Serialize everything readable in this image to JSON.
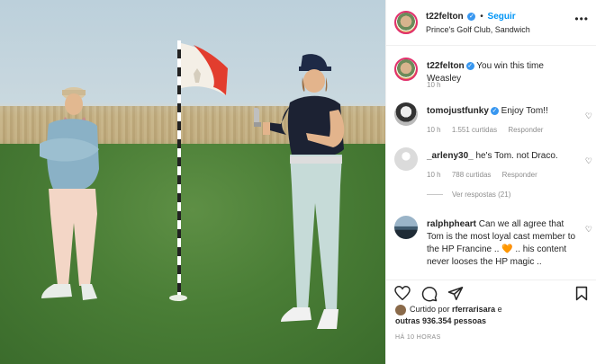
{
  "post": {
    "username": "t22felton",
    "follow_label": "Seguir",
    "location": "Prince's Golf Club, Sandwich"
  },
  "caption": {
    "username": "t22felton",
    "text": "You win this time Weasley",
    "time": "10 h"
  },
  "comments": [
    {
      "username": "tomojustfunky",
      "text": "Enjoy Tom!!",
      "time": "10 h",
      "likes": "1.551 curtidas",
      "reply_label": "Responder",
      "verified": true
    },
    {
      "username": "_arleny30_",
      "text": "he's Tom. not Draco.",
      "time": "10 h",
      "likes": "788 curtidas",
      "reply_label": "Responder",
      "verified": false
    },
    {
      "username": "ralphpheart",
      "text": "Can we all agree that Tom is the most loyal cast member to the HP Francine .. 🧡 .. his content never looses the HP magic ..",
      "verified": false
    }
  ],
  "view_replies": "Ver respostas (21)",
  "likes": {
    "prefix": "Curtido por",
    "user": "rferrarisara",
    "middle": "e",
    "others": "outras 936.354 pessoas"
  },
  "timestamp": "HÁ 10 HORAS",
  "icons": {
    "heart": "heart-icon",
    "comment": "comment-icon",
    "share": "share-icon",
    "save": "bookmark-icon",
    "more": "more-icon"
  },
  "colors": {
    "accent": "#0095f6",
    "verified": "#3897f0",
    "meta": "#8e8e8e"
  }
}
